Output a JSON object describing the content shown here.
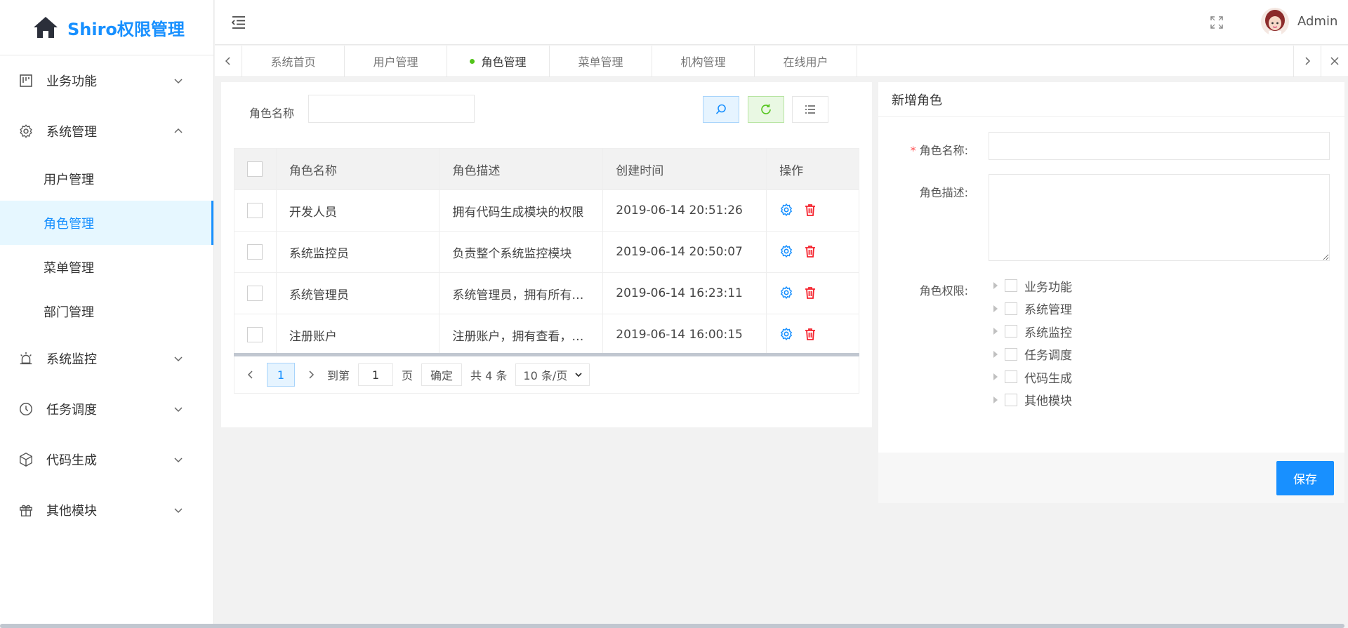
{
  "app": {
    "title": "Shiro权限管理"
  },
  "sidebar": {
    "menus": [
      {
        "label": "业务功能",
        "icon": "board-icon",
        "expanded": false
      },
      {
        "label": "系统管理",
        "icon": "gear-icon",
        "expanded": true,
        "children": [
          {
            "label": "用户管理",
            "active": false
          },
          {
            "label": "角色管理",
            "active": true
          },
          {
            "label": "菜单管理",
            "active": false
          },
          {
            "label": "部门管理",
            "active": false
          }
        ]
      },
      {
        "label": "系统监控",
        "icon": "alarm-icon",
        "expanded": false
      },
      {
        "label": "任务调度",
        "icon": "clock-icon",
        "expanded": false
      },
      {
        "label": "代码生成",
        "icon": "cube-icon",
        "expanded": false
      },
      {
        "label": "其他模块",
        "icon": "gift-icon",
        "expanded": false
      }
    ]
  },
  "header": {
    "username": "Admin"
  },
  "tabs": [
    {
      "label": "系统首页",
      "active": false
    },
    {
      "label": "用户管理",
      "active": false
    },
    {
      "label": "角色管理",
      "active": true
    },
    {
      "label": "菜单管理",
      "active": false
    },
    {
      "label": "机构管理",
      "active": false
    },
    {
      "label": "在线用户",
      "active": false
    }
  ],
  "search": {
    "label": "角色名称",
    "value": ""
  },
  "table": {
    "columns": [
      "角色名称",
      "角色描述",
      "创建时间",
      "操作"
    ],
    "rows": [
      {
        "name": "开发人员",
        "desc": "拥有代码生成模块的权限",
        "created": "2019-06-14 20:51:26"
      },
      {
        "name": "系统监控员",
        "desc": "负责整个系统监控模块",
        "created": "2019-06-14 20:50:07"
      },
      {
        "name": "系统管理员",
        "desc": "系统管理员，拥有所有…",
        "created": "2019-06-14 16:23:11"
      },
      {
        "name": "注册账户",
        "desc": "注册账户，拥有查看，…",
        "created": "2019-06-14 16:00:15"
      }
    ]
  },
  "pager": {
    "current": "1",
    "goto_label": "到第",
    "goto_value": "1",
    "page_unit": "页",
    "confirm": "确定",
    "total": "共 4 条",
    "page_size": "10 条/页"
  },
  "form": {
    "title": "新增角色",
    "name_label": "角色名称:",
    "desc_label": "角色描述:",
    "perm_label": "角色权限:",
    "permissions": [
      "业务功能",
      "系统管理",
      "系统监控",
      "任务调度",
      "代码生成",
      "其他模块"
    ],
    "save": "保存"
  },
  "colors": {
    "primary": "#1890ff",
    "danger": "#f5222d",
    "success": "#52c41a"
  }
}
